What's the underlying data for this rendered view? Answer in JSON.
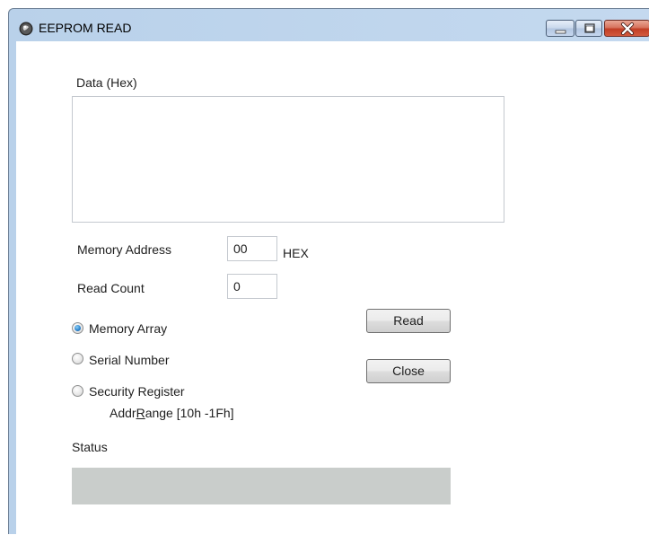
{
  "window": {
    "title": "EEPROM READ"
  },
  "data_hex": {
    "label": "Data (Hex)",
    "value": ""
  },
  "memory_address": {
    "label": "Memory Address",
    "value": "00",
    "unit": "HEX"
  },
  "read_count": {
    "label": "Read Count",
    "value": "0"
  },
  "options": [
    {
      "label": "Memory Array",
      "checked": true
    },
    {
      "label": "Serial Number",
      "checked": false
    },
    {
      "label": "Security Register",
      "checked": false
    }
  ],
  "addr_range": {
    "prefix": "Addr",
    "mnemonic": "R",
    "suffix": "ange [10h -1Fh]"
  },
  "buttons": {
    "read": "Read",
    "close": "Close"
  },
  "status": {
    "label": "Status",
    "value": ""
  },
  "icons": {
    "app": "app-icon",
    "minimize": "minimize-icon",
    "maximize": "maximize-icon",
    "close": "close-icon"
  },
  "colors": {
    "frame": "#b9d1ea",
    "close_button": "#c13e25",
    "status_bar": "#c9cdcb",
    "radio_checked": "#2f86cf"
  }
}
